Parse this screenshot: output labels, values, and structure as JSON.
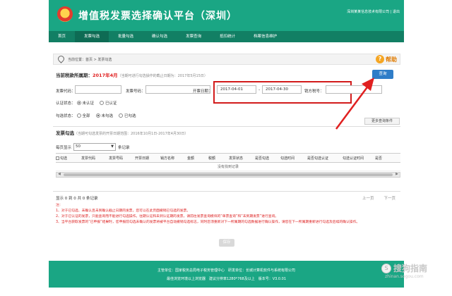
{
  "header": {
    "title": "增值税发票选择确认平台（深圳）",
    "user_info": "深圳某某信息技术有限公司 | 退出"
  },
  "nav": {
    "items": [
      "首页",
      "发票勾选",
      "批量勾选",
      "确认勾选",
      "发票查询",
      "抵扣统计",
      "档案信息维护"
    ]
  },
  "breadcrumb": {
    "text": "当前位置：首页 > 发票勾选",
    "help_label": "帮助"
  },
  "period": {
    "label": "当前税款所属期：",
    "value": "2017年4月",
    "hint": "（当期可进行勾选操作的截止日期为：2017年5月15日）"
  },
  "toolbar": {
    "query_label": "查询"
  },
  "form": {
    "invoice_code_label": "发票代码：",
    "invoice_code_value": "",
    "invoice_number_label": "发票号码：",
    "invoice_number_value": "",
    "date_label": "开票日期：",
    "date_start": "2017-04-01",
    "date_sep": "-",
    "date_end": "2017-04-30",
    "seller_tax_label": "销方税号：",
    "seller_tax_value": "",
    "auth_status_label": "认证状态：",
    "auth_options": [
      "未认证",
      "已认证"
    ],
    "check_status_label": "勾选状态：",
    "check_options": [
      "全部",
      "未勾选",
      "已勾选"
    ],
    "more_label": "更多查询条件"
  },
  "section": {
    "title": "发票勾选",
    "hint": "（当期可勾选发票的开票日期范围：2016年10月1日-2017年4月30日）"
  },
  "page_size": {
    "prefix": "每页显示",
    "value": "50",
    "suffix": "条记录"
  },
  "table": {
    "columns": [
      "勾选",
      "发票代码",
      "发票号码",
      "开票日期",
      "销方名称",
      "金额",
      "税额",
      "发票状态",
      "是否勾选",
      "勾选时间",
      "是否勾选认证",
      "勾选认证时间",
      "是否"
    ],
    "empty_text": "没有找到记录"
  },
  "records": {
    "text": "显示 0 到 0 共 0 条记录",
    "prev": "上一页",
    "next": "下一页"
  },
  "notes": {
    "title": "注：",
    "lines": [
      "1、对于已勾选、未确认且未到确认截止日期的发票，您可以在此页面撤销已勾选的发票。",
      "2、对于已认证的发票，只能查询而不能进行勾选操作。往期认证和未到认证期的发票，请前往发票查询模块的“单票查询”和“未到期发票”进行查询。",
      "3、当平台获取发票的“已申报”结果时，您申报前勾选未确认的发票将被平台自动撤销勾选标志，同时您须重新对下一所属期的勾选数据进行确认操作，请您在下一所属期重新进行勾选及后续的确认操作。"
    ],
    "submit_label": "保存"
  },
  "footer": {
    "line1": "主管单位：国家税务总局电子税务管理中心　研发单位：长城计算机软件与系统有限公司",
    "line2": "最佳浏览环境以上浏览器　建议分辨率1280*768及以上　版本号：V3.0.01"
  },
  "watermark": {
    "text": "搜狗指南",
    "url": "zhinan.sogou.com"
  }
}
